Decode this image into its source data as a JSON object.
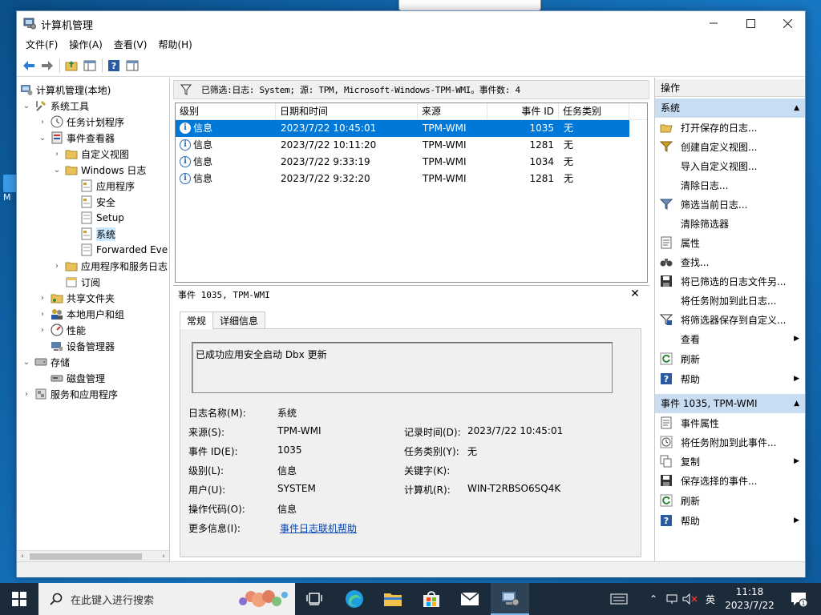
{
  "tooltip": {
    "text": ""
  },
  "desktop_icon": {
    "label": "M"
  },
  "window": {
    "title": "计算机管理"
  },
  "menu": [
    {
      "label": "文件(F)"
    },
    {
      "label": "操作(A)"
    },
    {
      "label": "查看(V)"
    },
    {
      "label": "帮助(H)"
    }
  ],
  "tree": {
    "items": [
      {
        "label": "计算机管理(本地)"
      },
      {
        "label": "系统工具"
      },
      {
        "label": "任务计划程序"
      },
      {
        "label": "事件查看器"
      },
      {
        "label": "自定义视图"
      },
      {
        "label": "Windows 日志"
      },
      {
        "label": "应用程序"
      },
      {
        "label": "安全"
      },
      {
        "label": "Setup"
      },
      {
        "label": "系统"
      },
      {
        "label": "Forwarded Eve"
      },
      {
        "label": "应用程序和服务日志"
      },
      {
        "label": "订阅"
      },
      {
        "label": "共享文件夹"
      },
      {
        "label": "本地用户和组"
      },
      {
        "label": "性能"
      },
      {
        "label": "设备管理器"
      },
      {
        "label": "存储"
      },
      {
        "label": "磁盘管理"
      },
      {
        "label": "服务和应用程序"
      }
    ]
  },
  "filter": {
    "text": "已筛选:日志: System; 源: TPM, Microsoft-Windows-TPM-WMI。事件数: 4"
  },
  "event_list": {
    "columns": [
      "级别",
      "日期和时间",
      "来源",
      "事件 ID",
      "任务类别"
    ],
    "rows": [
      {
        "level": "信息",
        "datetime": "2023/7/22 10:45:01",
        "source": "TPM-WMI",
        "event_id": "1035",
        "category": "无"
      },
      {
        "level": "信息",
        "datetime": "2023/7/22 10:11:20",
        "source": "TPM-WMI",
        "event_id": "1281",
        "category": "无"
      },
      {
        "level": "信息",
        "datetime": "2023/7/22 9:33:19",
        "source": "TPM-WMI",
        "event_id": "1034",
        "category": "无"
      },
      {
        "level": "信息",
        "datetime": "2023/7/22 9:32:20",
        "source": "TPM-WMI",
        "event_id": "1281",
        "category": "无"
      }
    ]
  },
  "detail": {
    "title": "事件 1035, TPM-WMI",
    "tabs": [
      "常规",
      "详细信息"
    ],
    "description": "已成功应用安全启动 Dbx 更新",
    "labels": {
      "log_name": "日志名称(M):",
      "source": "来源(S):",
      "event_id": "事件 ID(E):",
      "level": "级别(L):",
      "user": "用户(U):",
      "opcode": "操作代码(O):",
      "more_info": "更多信息(I):",
      "logged": "记录时间(D):",
      "task_category": "任务类别(Y):",
      "keywords": "关键字(K):",
      "computer": "计算机(R):"
    },
    "values": {
      "log_name": "系统",
      "source": "TPM-WMI",
      "event_id": "1035",
      "level": "信息",
      "user": "SYSTEM",
      "opcode": "信息",
      "more_info": "事件日志联机帮助",
      "logged": "2023/7/22 10:45:01",
      "task_category": "无",
      "keywords": "",
      "computer": "WIN-T2RBSO6SQ4K"
    }
  },
  "actions": {
    "header": "操作",
    "section1": "系统",
    "section1_items": [
      {
        "label": "打开保存的日志..."
      },
      {
        "label": "创建自定义视图..."
      },
      {
        "label": "导入自定义视图..."
      },
      {
        "label": "清除日志..."
      },
      {
        "label": "筛选当前日志..."
      },
      {
        "label": "清除筛选器"
      },
      {
        "label": "属性"
      },
      {
        "label": "查找..."
      },
      {
        "label": "将已筛选的日志文件另..."
      },
      {
        "label": "将任务附加到此日志..."
      },
      {
        "label": "将筛选器保存到自定义..."
      },
      {
        "label": "查看"
      },
      {
        "label": "刷新"
      },
      {
        "label": "帮助"
      }
    ],
    "section2": "事件 1035, TPM-WMI",
    "section2_items": [
      {
        "label": "事件属性"
      },
      {
        "label": "将任务附加到此事件..."
      },
      {
        "label": "复制"
      },
      {
        "label": "保存选择的事件..."
      },
      {
        "label": "刷新"
      },
      {
        "label": "帮助"
      }
    ]
  },
  "taskbar": {
    "search_placeholder": "在此键入进行搜索",
    "ime": "英",
    "time": "11:18",
    "date": "2023/7/22",
    "notification_count": "1"
  },
  "colors": {
    "selection": "#0078d7",
    "action_section": "#c8dcf2",
    "taskbar": "#1c2b3a",
    "link": "#0645ad"
  }
}
